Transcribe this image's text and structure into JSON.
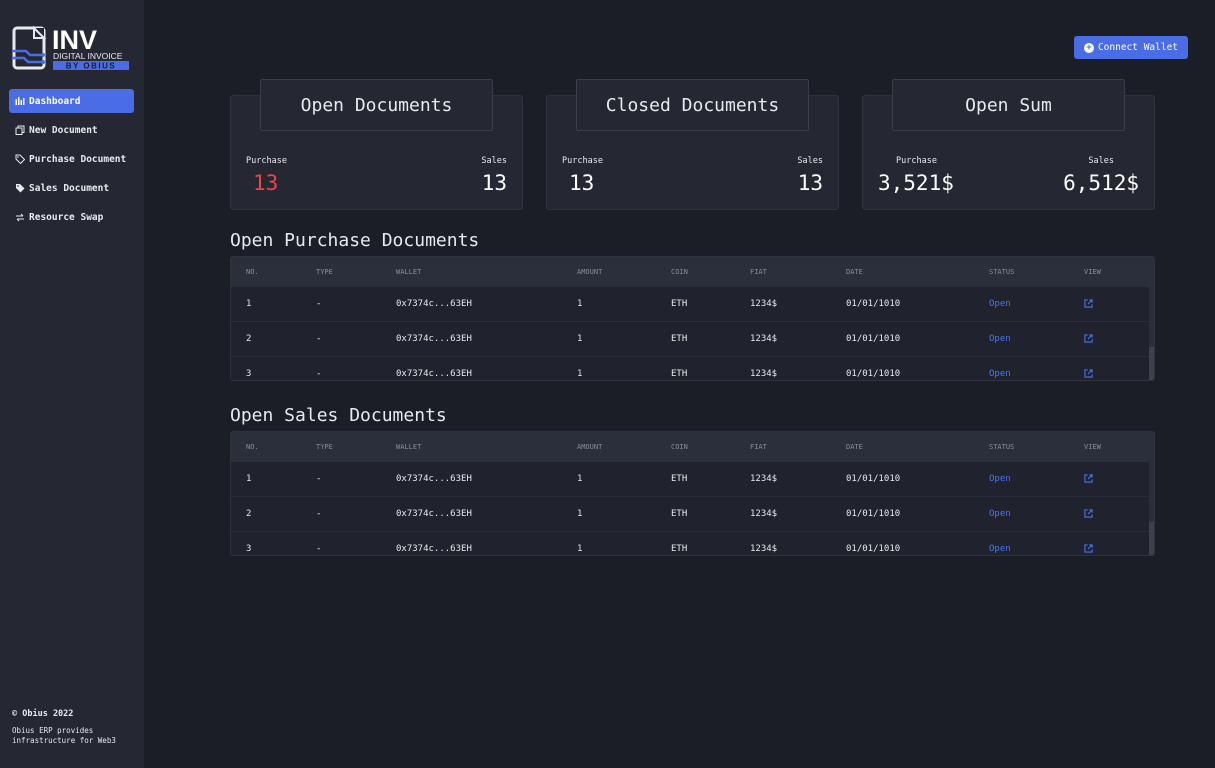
{
  "brand": {
    "logo_main": "INV",
    "logo_sub": "DIGITAL INVOICE",
    "logo_by": "BY OBIUS"
  },
  "sidebar": {
    "items": [
      {
        "label": "Dashboard",
        "icon": "bar-chart-icon",
        "active": true
      },
      {
        "label": "New Document",
        "icon": "copy-icon"
      },
      {
        "label": "Purchase Document",
        "icon": "tag-outline-icon"
      },
      {
        "label": "Sales Document",
        "icon": "tag-filled-icon"
      },
      {
        "label": "Resource Swap",
        "icon": "swap-icon"
      }
    ],
    "footer_copy": "© Obius 2022",
    "footer_text_1": "Obius ERP provides",
    "footer_text_2": "infrastructure for Web3"
  },
  "header": {
    "connect_label": "Connect Wallet"
  },
  "cards": [
    {
      "title": "Open Documents",
      "left_label": "Purchase",
      "left_value": "13",
      "right_label": "Sales",
      "right_value": "13"
    },
    {
      "title": "Closed Documents",
      "left_label": "Purchase",
      "left_value": "13",
      "right_label": "Sales",
      "right_value": "13"
    },
    {
      "title": "Open Sum",
      "left_label": "Purchase",
      "left_value": "3,521$",
      "right_label": "Sales",
      "right_value": "6,512$"
    }
  ],
  "columns": [
    "NO.",
    "TYPE",
    "WALLET",
    "AMOUNT",
    "COIN",
    "FIAT",
    "DATE",
    "STATUS",
    "VIEW"
  ],
  "purchase": {
    "title": "Open Purchase Documents",
    "rows": [
      {
        "no": "1",
        "type": "-",
        "wallet": "0x7374c...63EH",
        "amount": "1",
        "coin": "ETH",
        "fiat": "1234$",
        "date": "01/01/1010",
        "status": "Open"
      },
      {
        "no": "2",
        "type": "-",
        "wallet": "0x7374c...63EH",
        "amount": "1",
        "coin": "ETH",
        "fiat": "1234$",
        "date": "01/01/1010",
        "status": "Open"
      },
      {
        "no": "3",
        "type": "-",
        "wallet": "0x7374c...63EH",
        "amount": "1",
        "coin": "ETH",
        "fiat": "1234$",
        "date": "01/01/1010",
        "status": "Open"
      }
    ]
  },
  "sales": {
    "title": "Open Sales Documents",
    "rows": [
      {
        "no": "1",
        "type": "-",
        "wallet": "0x7374c...63EH",
        "amount": "1",
        "coin": "ETH",
        "fiat": "1234$",
        "date": "01/01/1010",
        "status": "Open"
      },
      {
        "no": "2",
        "type": "-",
        "wallet": "0x7374c...63EH",
        "amount": "1",
        "coin": "ETH",
        "fiat": "1234$",
        "date": "01/01/1010",
        "status": "Open"
      },
      {
        "no": "3",
        "type": "-",
        "wallet": "0x7374c...63EH",
        "amount": "1",
        "coin": "ETH",
        "fiat": "1234$",
        "date": "01/01/1010",
        "status": "Open"
      }
    ]
  },
  "colors": {
    "accent": "#4a6de5",
    "negative": "#f0414c",
    "status_link": "#4a74f0",
    "background": "#1b1d27",
    "panel": "#252833"
  }
}
